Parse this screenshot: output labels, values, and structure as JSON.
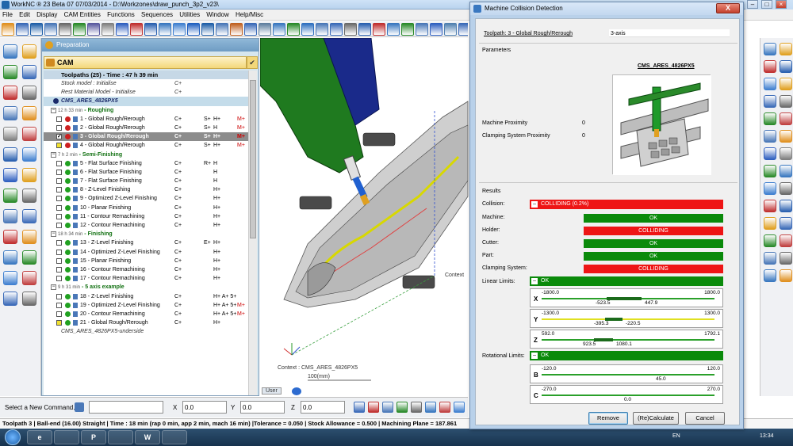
{
  "window": {
    "title": "WorkNC ® 23 Beta 07   07/03/2014 - D:\\Workzones\\draw_punch_3p2_v23\\",
    "minimize": "–",
    "maximize": "□",
    "close": "×"
  },
  "menu": [
    "File",
    "Edit",
    "Display",
    "CAM Entities",
    "Functions",
    "Sequences",
    "Utilities",
    "Window",
    "Help/Misc"
  ],
  "tree": {
    "header": "Preparation",
    "cam_label": "CAM",
    "cam_check": "✔",
    "toolpaths_header": "Toolpaths (25) - Time : 47 h 39 min",
    "rows": [
      {
        "kind": "italic",
        "label": "Stock model : Initialise",
        "c1": "C+",
        "c2": "",
        "c3": "",
        "c4": ""
      },
      {
        "kind": "italic",
        "label": "Rest Material Model - Initialise",
        "c1": "C+",
        "c2": "",
        "c3": "",
        "c4": ""
      },
      {
        "kind": "machine",
        "label": "CMS_ARES_4826PX5",
        "c1": "",
        "c2": "",
        "c3": "",
        "c4": ""
      },
      {
        "kind": "group",
        "time": "12 h 33 min",
        "label": "Roughing",
        "c1": "",
        "c2": "",
        "c3": "",
        "c4": ""
      },
      {
        "kind": "tp",
        "label": "1 - Global Rough/Rerough",
        "c1": "C+",
        "c2": "S+",
        "c3": "H+",
        "c4": "M+",
        "dot": "#cc2020",
        "checked": false
      },
      {
        "kind": "tp",
        "label": "2 - Global Rough/Rerough",
        "c1": "C+",
        "c2": "S+",
        "c3": "H",
        "c4": "M+",
        "dot": "#cc2020",
        "checked": false
      },
      {
        "kind": "sel",
        "label": "3 - Global Rough/Rerough",
        "c1": "C+",
        "c2": "S+",
        "c3": "H+",
        "c4": "M+",
        "dot": "#cc2020",
        "checked": true
      },
      {
        "kind": "tp",
        "label": "4 - Global Rough/Rerough",
        "c1": "C+",
        "c2": "S+",
        "c3": "H+",
        "c4": "M+",
        "dot": "#cc2020",
        "checked": false,
        "yellow": true
      },
      {
        "kind": "group",
        "time": "7 h 2 min",
        "label": "Semi-Finishing",
        "c1": "",
        "c2": "",
        "c3": "",
        "c4": ""
      },
      {
        "kind": "tp",
        "label": "5 - Flat Surface Finishing",
        "c1": "C+",
        "c2": "R+",
        "c3": "H",
        "c4": "",
        "dot": "#20a020",
        "checked": false
      },
      {
        "kind": "tp",
        "label": "6 - Flat Surface Finishing",
        "c1": "C+",
        "c2": "",
        "c3": "H",
        "c4": "",
        "dot": "#20a020",
        "checked": false
      },
      {
        "kind": "tp",
        "label": "7 - Flat Surface Finishing",
        "c1": "C+",
        "c2": "",
        "c3": "H",
        "c4": "",
        "dot": "#20a020",
        "checked": false
      },
      {
        "kind": "tp",
        "label": "8 - Z-Level Finishing",
        "c1": "C+",
        "c2": "",
        "c3": "H+",
        "c4": "",
        "dot": "#20a020",
        "checked": false
      },
      {
        "kind": "tp",
        "label": "9 - Optimized Z-Level Finishing",
        "c1": "C+",
        "c2": "",
        "c3": "H+",
        "c4": "",
        "dot": "#20a020",
        "checked": false
      },
      {
        "kind": "tp",
        "label": "10 - Planar Finishing",
        "c1": "C+",
        "c2": "",
        "c3": "H+",
        "c4": "",
        "dot": "#20a020",
        "checked": false
      },
      {
        "kind": "tp",
        "label": "11 - Contour Remachining",
        "c1": "C+",
        "c2": "",
        "c3": "H+",
        "c4": "",
        "dot": "#20a020",
        "checked": false
      },
      {
        "kind": "tp",
        "label": "12 - Contour Remachining",
        "c1": "C+",
        "c2": "",
        "c3": "H+",
        "c4": "",
        "dot": "#20a020",
        "checked": false
      },
      {
        "kind": "group",
        "time": "18 h 34 min",
        "label": "Finishing",
        "c1": "",
        "c2": "",
        "c3": "",
        "c4": ""
      },
      {
        "kind": "tp",
        "label": "13 - Z-Level Finishing",
        "c1": "C+",
        "c2": "E+",
        "c3": "H+",
        "c4": "",
        "dot": "#20a020",
        "checked": false
      },
      {
        "kind": "tp",
        "label": "14 - Optimized Z-Level Finishing",
        "c1": "C+",
        "c2": "",
        "c3": "H+",
        "c4": "",
        "dot": "#20a020",
        "checked": false
      },
      {
        "kind": "tp",
        "label": "15 - Planar Finishing",
        "c1": "C+",
        "c2": "",
        "c3": "H+",
        "c4": "",
        "dot": "#20a020",
        "checked": false
      },
      {
        "kind": "tp",
        "label": "16 - Contour Remachining",
        "c1": "C+",
        "c2": "",
        "c3": "H+",
        "c4": "",
        "dot": "#20a020",
        "checked": false
      },
      {
        "kind": "tp",
        "label": "17 - Contour Remachining",
        "c1": "C+",
        "c2": "",
        "c3": "H+",
        "c4": "",
        "dot": "#20a020",
        "checked": false
      },
      {
        "kind": "group",
        "time": "9 h 31 min",
        "label": "5 axis example",
        "c1": "",
        "c2": "",
        "c3": "",
        "c4": ""
      },
      {
        "kind": "tp",
        "label": "18 - Z-Level Finishing",
        "c1": "C+",
        "c2": "",
        "c3": "H+ A+ 5+",
        "c4": "",
        "dot": "#20a020",
        "checked": false
      },
      {
        "kind": "tp",
        "label": "19 - Optimized Z-Level Finishing",
        "c1": "C+",
        "c2": "",
        "c3": "H+ A+ 5+",
        "c4": "M+",
        "dot": "#20a020",
        "checked": false
      },
      {
        "kind": "tp",
        "label": "20 - Contour Remachining",
        "c1": "C+",
        "c2": "",
        "c3": "H+ A+ 5+",
        "c4": "M+",
        "dot": "#20a020",
        "checked": false
      },
      {
        "kind": "tp",
        "label": "21 - Global Rough/Rerough",
        "c1": "C+",
        "c2": "",
        "c3": "H+",
        "c4": "",
        "dot": "#20a020",
        "checked": false,
        "yellow": true
      },
      {
        "kind": "italic2",
        "label": "CMS_ARES_4826PX5-underside",
        "c1": "",
        "c2": "",
        "c3": "",
        "c4": ""
      }
    ]
  },
  "viewport": {
    "context_label": "Context",
    "context_text": "Context : CMS_ARES_4826PX5",
    "scale_text": "100(mm)",
    "tab_user": "User"
  },
  "command": {
    "label": "Select a New Command...",
    "x_label": "X",
    "y_label": "Y",
    "z_label": "Z",
    "x_value": "0.0",
    "y_value": "0.0",
    "z_value": "0.0"
  },
  "status": "Toolpath 3 | Ball-end (16.00) Straight | Time : 18 min (rap 0 min, app 2 min, mach 16 min) |Tolerance = 0.050 | Stock Allowance = 0.500 | Machining Plane = 187.861",
  "taskbar": {
    "lang": "EN",
    "time": "13:34",
    "apps": [
      "e",
      "",
      "P",
      "",
      "W",
      ""
    ]
  },
  "dialog": {
    "title": "Machine Collision Detection",
    "close": "X",
    "toolpath_label": "Toolpath: 3 - Global Rough/Rerough",
    "toolpath_axis": "3-axis",
    "parameters_label": "Parameters",
    "machine_name": "CMS_ARES_4826PX5",
    "machine_proximity_label": "Machine Proximity",
    "machine_proximity_value": "0",
    "clamping_proximity_label": "Clamping System Proximity",
    "clamping_proximity_value": "0",
    "results_label": "Results",
    "collision_label": "Collision:",
    "collision_value": "COLLIDING (0.2%)",
    "items": [
      {
        "label": "Machine:",
        "status": "OK",
        "ok": true
      },
      {
        "label": "Holder:",
        "status": "COLLIDING",
        "ok": false
      },
      {
        "label": "Cutter:",
        "status": "OK",
        "ok": true
      },
      {
        "label": "Part:",
        "status": "OK",
        "ok": true
      },
      {
        "label": "Clamping System:",
        "status": "COLLIDING",
        "ok": false
      }
    ],
    "linear_limits_label": "Linear Limits:",
    "linear_limits_value": "OK",
    "x_axis": {
      "axis": "X",
      "min": "-1800.0",
      "max": "1800.0",
      "lo": "-523.5",
      "hi": "447.9"
    },
    "y_axis": {
      "axis": "Y",
      "min": "-1300.0",
      "max": "1300.0",
      "lo": "-395.3",
      "hi": "-220.5"
    },
    "z_axis": {
      "axis": "Z",
      "min": "592.0",
      "max": "1792.1",
      "lo": "923.5",
      "hi": "1080.1"
    },
    "rotational_limits_label": "Rotational Limits:",
    "rotational_limits_value": "OK",
    "b_axis": {
      "axis": "B",
      "min": "-120.0",
      "max": "120.0",
      "lo": "45.0"
    },
    "c_axis": {
      "axis": "C",
      "min": "-270.0",
      "max": "270.0",
      "lo": "0.0"
    },
    "remove_button": "Remove",
    "recalculate_button": "(Re)Calculate",
    "cancel_button": "Cancel"
  },
  "colors": {
    "ok_green": "#0a8a0a",
    "colliding_red": "#ee1515",
    "cam_yellow": "#f3d77a"
  }
}
